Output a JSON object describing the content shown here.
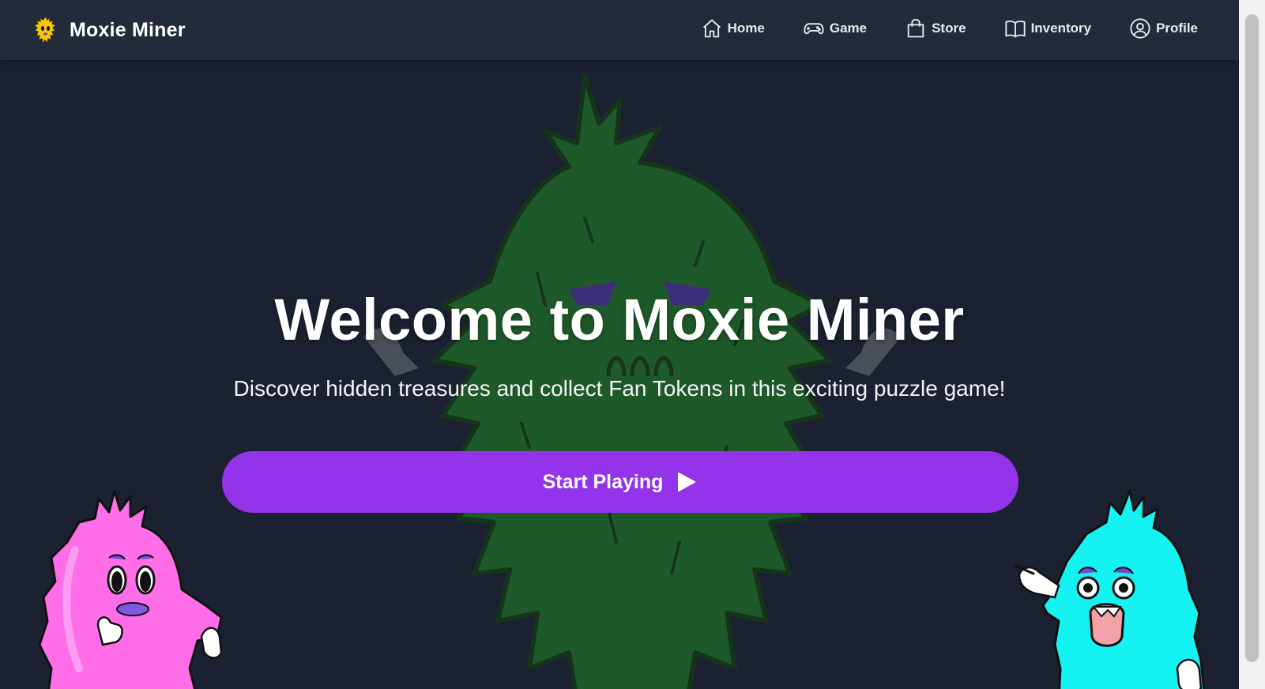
{
  "app": {
    "brand_name": "Moxie Miner"
  },
  "nav": {
    "items": [
      {
        "label": "Home",
        "icon": "home-icon"
      },
      {
        "label": "Game",
        "icon": "gamepad-icon"
      },
      {
        "label": "Store",
        "icon": "shopping-bag-icon"
      },
      {
        "label": "Inventory",
        "icon": "book-icon"
      },
      {
        "label": "Profile",
        "icon": "user-circle-icon"
      }
    ]
  },
  "hero": {
    "title": "Welcome to Moxie Miner",
    "subtitle": "Discover hidden treasures and collect Fan Tokens in this exciting puzzle game!",
    "cta_label": "Start Playing",
    "cta_icon": "play-icon"
  },
  "colors": {
    "nav_bg": "#232a3a",
    "page_bg": "#1b2131",
    "accent": "#9333ea",
    "monster_bg": "#1f5a2a",
    "monster_pink": "#ff6ee8",
    "monster_cyan": "#14f2f2",
    "logo_yellow": "#f5c800"
  }
}
